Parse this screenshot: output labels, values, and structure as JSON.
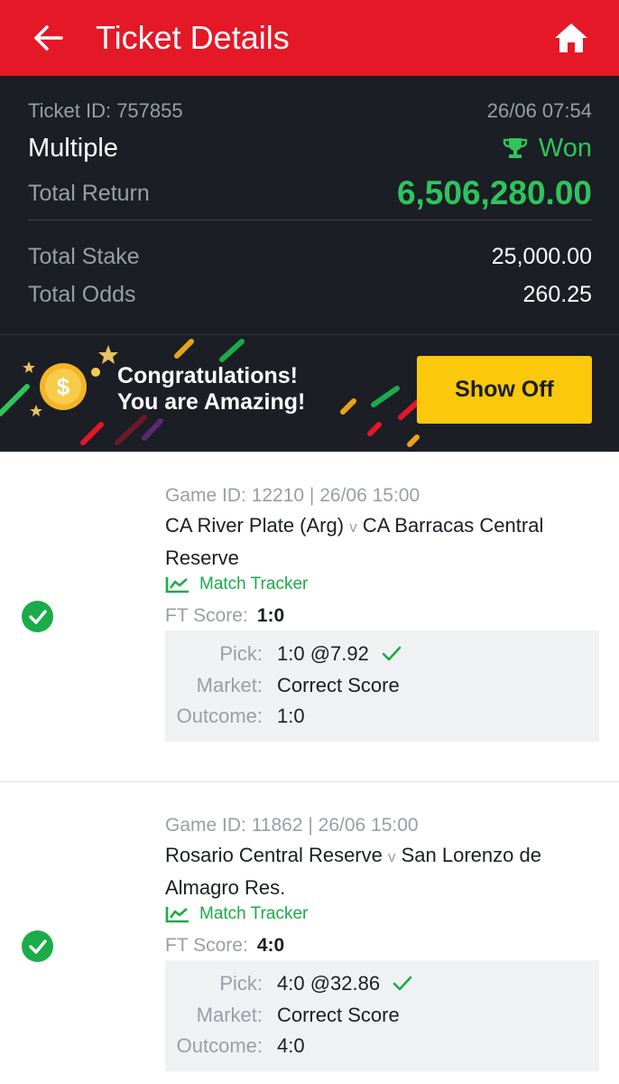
{
  "header": {
    "title": "Ticket Details",
    "back_icon": "arrow-left-icon",
    "home_icon": "home-icon"
  },
  "summary": {
    "ticket_id": "Ticket ID: 757855",
    "datetime": "26/06 07:54",
    "bet_type": "Multiple",
    "status": "Won",
    "total_return_label": "Total Return",
    "total_return": "6,506,280.00",
    "total_stake_label": "Total Stake",
    "total_stake": "25,000.00",
    "total_odds_label": "Total Odds",
    "total_odds": "260.25"
  },
  "banner": {
    "line1": "Congratulations!",
    "line2": "You are Amazing!",
    "button_label": "Show Off"
  },
  "labels": {
    "match_tracker": "Match Tracker",
    "ft_score": "FT Score:",
    "pick": "Pick:",
    "market": "Market:",
    "outcome": "Outcome:",
    "vs": "v"
  },
  "selections": [
    {
      "game_id": "Game ID: 12210 | 26/06 15:00",
      "home": "CA River Plate (Arg)",
      "away": "CA Barracas Central Reserve",
      "ft_score": "1:0",
      "pick": "1:0 @7.92",
      "market": "Correct Score",
      "outcome": "1:0"
    },
    {
      "game_id": "Game ID: 11862 | 26/06 15:00",
      "home": "Rosario Central Reserve",
      "away": "San Lorenzo de Almagro Res.",
      "ft_score": "4:0",
      "pick": "4:0 @32.86",
      "market": "Correct Score",
      "outcome": "4:0"
    }
  ],
  "colors": {
    "brand_red": "#e41827",
    "dark_bg": "#1b1e25",
    "won_green": "#2fc45c",
    "check_green": "#1bab48",
    "button_yellow": "#fbc80c"
  }
}
